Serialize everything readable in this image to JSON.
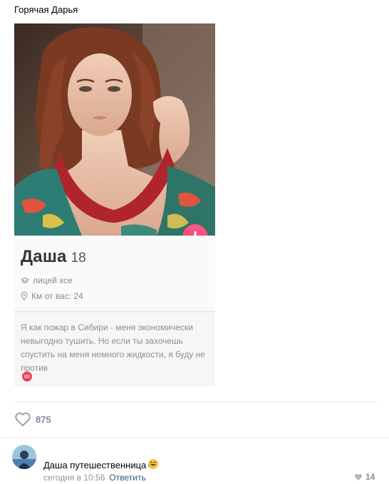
{
  "post": {
    "author": "Горячая Дарья"
  },
  "profile_card": {
    "name": "Даша",
    "age": "18",
    "school": "лицей хсе",
    "distance": "Км от вас: 24",
    "bio": "Я как пожар в Сибири - меня экономически невыгодно тушить. Но если ты захочешь спустить на меня немного жидкости, я буду не против",
    "accent_color": "#f0386b"
  },
  "likes": {
    "count": "875",
    "icon": "heart-outline-icon"
  },
  "comment": {
    "text": "Даша путешественница",
    "emoji": "rofl-emoji",
    "time": "сегодня в 10:56",
    "reply_label": "Ответить",
    "like_count": "14"
  }
}
